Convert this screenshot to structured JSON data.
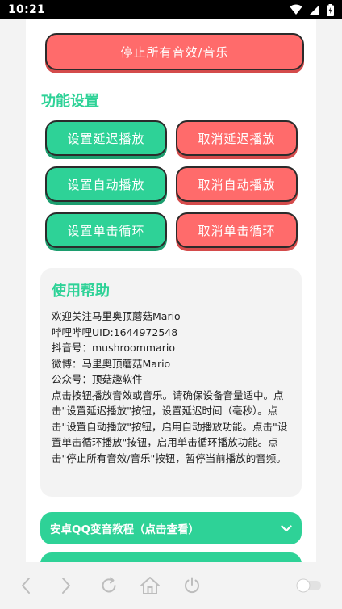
{
  "status_bar": {
    "time": "10:21"
  },
  "top_button": {
    "label": "停止所有音效/音乐"
  },
  "section": {
    "title": "功能设置"
  },
  "buttons": {
    "set_delay": "设置延迟播放",
    "cancel_delay": "取消延迟播放",
    "set_auto": "设置自动播放",
    "cancel_auto": "取消自动播放",
    "set_loop": "设置单击循环",
    "cancel_loop": "取消单击循环"
  },
  "help": {
    "title": "使用帮助",
    "lines": [
      "欢迎关注马里奥顶蘑菇Mario",
      "哔哩哔哩UID:1644972548",
      "抖音号：mushroommario",
      "微博：马里奥顶蘑菇Mario",
      "公众号：顶菇趣软件"
    ],
    "paragraph": "点击按钮播放音效或音乐。请确保设备音量适中。点击\"设置延迟播放\"按钮，设置延迟时间（毫秒）。点击\"设置自动播放\"按钮，启用自动播放功能。点击\"设置单击循环播放\"按钮，启用单击循环播放功能。点击\"停止所有音效/音乐\"按钮，暂停当前播放的音频。"
  },
  "accordion": {
    "title": "安卓QQ变音教程（点击查看）"
  },
  "colors": {
    "accent_green": "#2ed297",
    "accent_red": "#ff6b6b"
  },
  "nav_icons": [
    "back-icon",
    "forward-icon",
    "refresh-icon",
    "home-icon",
    "power-icon",
    "toggle-switch"
  ]
}
